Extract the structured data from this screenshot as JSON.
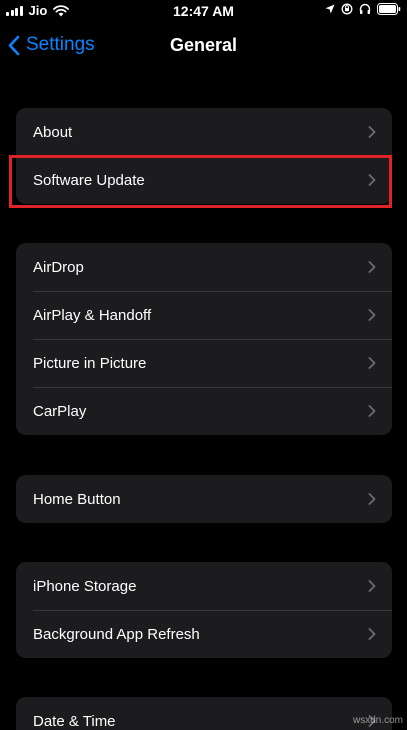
{
  "status_bar": {
    "carrier": "Jio",
    "time": "12:47 AM"
  },
  "nav": {
    "back_label": "Settings",
    "title": "General"
  },
  "groups": [
    {
      "rows": [
        {
          "label": "About"
        },
        {
          "label": "Software Update"
        }
      ]
    },
    {
      "rows": [
        {
          "label": "AirDrop"
        },
        {
          "label": "AirPlay & Handoff"
        },
        {
          "label": "Picture in Picture"
        },
        {
          "label": "CarPlay"
        }
      ]
    },
    {
      "rows": [
        {
          "label": "Home Button"
        }
      ]
    },
    {
      "rows": [
        {
          "label": "iPhone Storage"
        },
        {
          "label": "Background App Refresh"
        }
      ]
    },
    {
      "rows": [
        {
          "label": "Date & Time"
        }
      ]
    }
  ],
  "highlighted_item": "Software Update",
  "watermark": "wsxdn.com",
  "colors": {
    "background": "#000000",
    "cell": "#1c1c1e",
    "accent": "#0a84ff",
    "highlight": "#e0232b"
  }
}
